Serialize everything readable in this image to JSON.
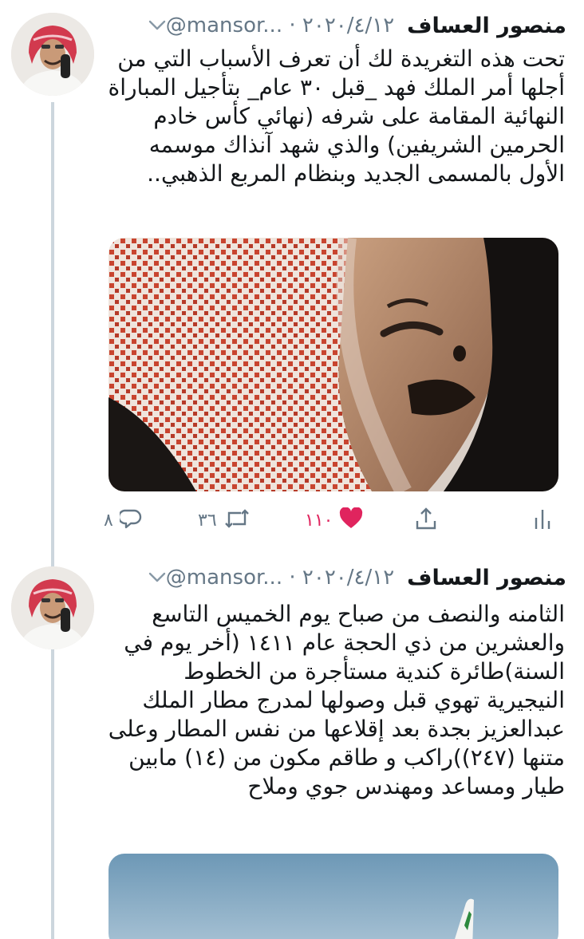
{
  "tweets": [
    {
      "author": "منصور العساف",
      "meta": "@mansor... · ٢٠٢٠/٤/١٢",
      "text": "تحت هذه التغريدة لك أن تعرف الأسباب التي من أجلها أمر الملك فهد _قبل ٣٠ عام_ بتأجيل المباراة النهائية المقامة على شرفه (نهائي كأس خادم الحرمين الشريفين) والذي شهد آنذاك موسمه الأول بالمسمى الجديد وبنظام المربع الذهبي..",
      "reply_count": "٨",
      "retweet_count": "٣٦",
      "like_count": "١١٠"
    },
    {
      "author": "منصور العساف",
      "meta": "@mansor... · ٢٠٢٠/٤/١٢",
      "text": "الثامنه والنصف من صباح يوم الخميس التاسع والعشرين من ذي الحجة عام ١٤١١ (أخر يوم في السنة)طائرة كندية مستأجرة من الخطوط النيجيرية تهوي قبل وصولها لمدرج مطار الملك عبدالعزيز بجدة بعد إقلاعها من نفس المطار وعلى متنها (٢٤٧))راكب و طاقم مكون من (١٤) مابين طيار ومساعد ومهندس جوي وملاح"
    }
  ],
  "icons": {
    "reply": "reply-icon",
    "retweet": "retweet-icon",
    "like": "heart-icon",
    "share": "share-icon",
    "stats": "analytics-icon",
    "more": "chevron-down-icon"
  },
  "colors": {
    "like": "#e0245e",
    "secondary_text": "#657786",
    "thread_line": "#ccd6dd"
  }
}
